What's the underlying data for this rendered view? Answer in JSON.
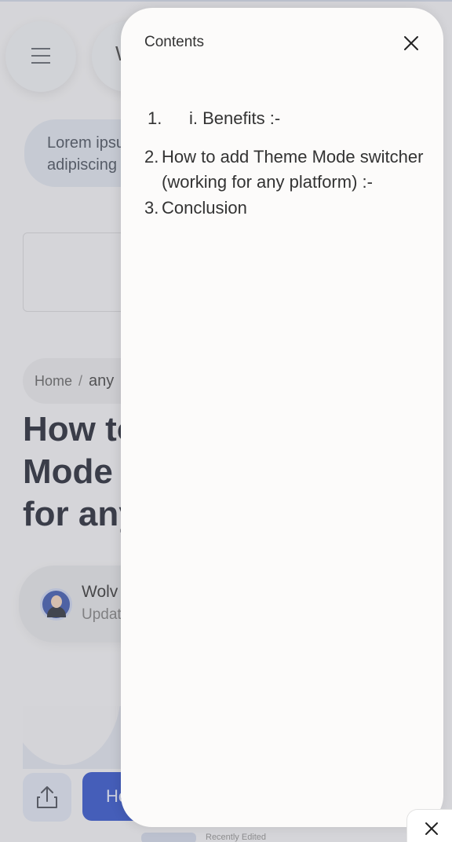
{
  "header": {
    "logo_letter": "W"
  },
  "intro": {
    "lorem_line1": "Lorem ipsum dolor sit amet,",
    "lorem_line2": "adipiscing elit"
  },
  "breadcrumb": {
    "home": "Home",
    "separator": "/",
    "current": "any"
  },
  "article": {
    "title_line1": "How to add Theme",
    "title_line2": "Mode switcher",
    "title_line3": "for any platform"
  },
  "author": {
    "name": "Wolv",
    "updated": "Updat"
  },
  "actions": {
    "primary_label": "He"
  },
  "footer": {
    "text": "Recently Edited"
  },
  "contents_drawer": {
    "title": "Contents",
    "items": [
      {
        "number": "1.",
        "label": "i. Benefits :-"
      },
      {
        "number": "2.",
        "label": "How to add Theme Mode switcher (working for any platform) :-"
      },
      {
        "number": "3.",
        "label": "Conclusion"
      }
    ]
  },
  "colors": {
    "accent": "#1f45c8",
    "overlay": "#96969b"
  }
}
